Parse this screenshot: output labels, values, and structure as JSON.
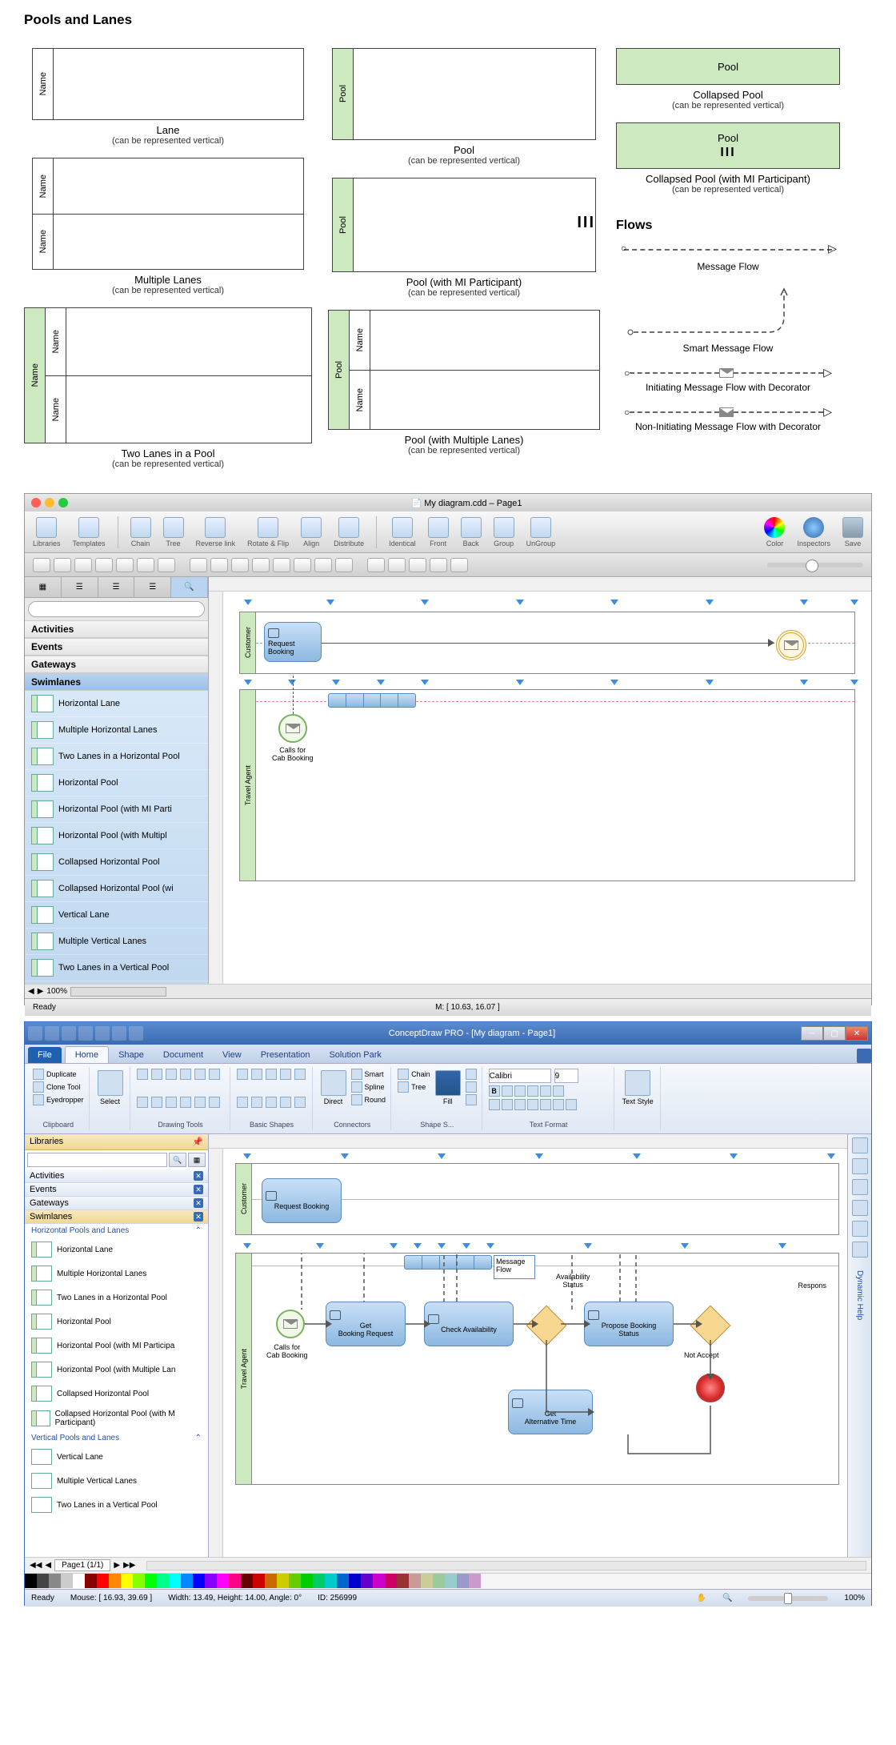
{
  "section_title": "Pools and Lanes",
  "shapes": {
    "lane": {
      "label": "Lane",
      "sub": "(can be represented vertical)",
      "name": "Name"
    },
    "multi_lanes": {
      "label": "Multiple Lanes",
      "sub": "(can be represented vertical)",
      "name1": "Name",
      "name2": "Name"
    },
    "two_lanes_pool": {
      "label": "Two Lanes in a Pool",
      "sub": "(can be represented vertical)",
      "pool": "Name",
      "lane1": "Name",
      "lane2": "Name"
    },
    "pool": {
      "label": "Pool",
      "sub": "(can be represented vertical)",
      "name": "Pool"
    },
    "pool_mi": {
      "label": "Pool (with MI Participant)",
      "sub": "(can be represented vertical)",
      "name": "Pool",
      "marker": "III"
    },
    "pool_multi": {
      "label": "Pool (with Multiple Lanes)",
      "sub": "(can be represented vertical)",
      "pool": "Pool",
      "lane1": "Name",
      "lane2": "Name"
    },
    "collapsed": {
      "label": "Collapsed Pool",
      "sub": "(can be represented vertical)",
      "name": "Pool"
    },
    "collapsed_mi": {
      "label": "Collapsed Pool (with MI Participant)",
      "sub": "(can be represented vertical)",
      "name": "Pool",
      "marker": "III"
    }
  },
  "flows": {
    "title": "Flows",
    "msg_flow": "Message Flow",
    "smart_msg_flow": "Smart Message Flow",
    "init_deco": "Initiating Message Flow with Decorator",
    "noninit_deco": "Non-Initiating Message Flow with Decorator"
  },
  "mac": {
    "title": "My diagram.cdd – Page1",
    "toolbar": [
      "Libraries",
      "Templates",
      "Chain",
      "Tree",
      "Reverse link",
      "Rotate & Flip",
      "Align",
      "Distribute",
      "Identical",
      "Front",
      "Back",
      "Group",
      "UnGroup",
      "Color",
      "Inspectors",
      "Save"
    ],
    "categories": [
      "Activities",
      "Events",
      "Gateways",
      "Swimlanes"
    ],
    "swimlane_items": [
      "Horizontal Lane",
      "Multiple Horizontal Lanes",
      "Two Lanes in a Horizontal Pool",
      "Horizontal Pool",
      "Horizontal Pool (with MI Parti",
      "Horizontal Pool (with Multipl",
      "Collapsed Horizontal Pool",
      "Collapsed Horizontal Pool (wi",
      "Vertical Lane",
      "Multiple Vertical Lanes",
      "Two Lanes in a Vertical Pool"
    ],
    "canvas": {
      "lane1": "Customer",
      "lane2": "Travel Agent",
      "task1": "Request Booking",
      "event1": "Calls for\nCab Booking"
    },
    "status": {
      "ready": "Ready",
      "zoom": "100%",
      "mouse": "M: [ 10.63, 16.07 ]"
    }
  },
  "win": {
    "title": "ConceptDraw PRO - [My diagram - Page1]",
    "tabs": [
      "File",
      "Home",
      "Shape",
      "Document",
      "View",
      "Presentation",
      "Solution Park"
    ],
    "clipboard": {
      "duplicate": "Duplicate",
      "clone": "Clone Tool",
      "eyedropper": "Eyedropper",
      "label": "Clipboard"
    },
    "groups": {
      "select": "Select",
      "drawing": "Drawing Tools",
      "shapes": "Basic Shapes",
      "direct": "Direct",
      "smart": "Smart",
      "spline": "Spline",
      "round": "Round",
      "connectors": "Connectors",
      "chain": "Chain",
      "tree": "Tree",
      "fill": "Fill",
      "shape_s": "Shape S...",
      "font": "Calibri",
      "font_size": "9",
      "text_format": "Text Format",
      "text_style": "Text Style"
    },
    "sidebar": {
      "header": "Libraries",
      "categories": [
        "Activities",
        "Events",
        "Gateways",
        "Swimlanes"
      ],
      "subcat1": "Horizontal Pools and Lanes",
      "subcat2": "Vertical Pools and Lanes",
      "items_h": [
        "Horizontal Lane",
        "Multiple Horizontal Lanes",
        "Two Lanes in a Horizontal Pool",
        "Horizontal Pool",
        "Horizontal Pool (with MI Participa",
        "Horizontal Pool (with Multiple Lan",
        "Collapsed Horizontal Pool",
        "Collapsed Horizontal Pool (with M Participant)"
      ],
      "items_v": [
        "Vertical Lane",
        "Multiple Vertical Lanes",
        "Two Lanes in a Vertical Pool"
      ]
    },
    "canvas": {
      "lane1": "Customer",
      "lane2": "Travel Agent",
      "task_req": "Request Booking",
      "event_call": "Calls for\nCab Booking",
      "task_get": "Get\nBooking Request",
      "task_check": "Check Availability",
      "msg_flow_label": "Message\nFlow",
      "avail_status": "Availability\nStatus",
      "task_propose": "Propose Booking\nStatus",
      "task_alt": "Get\nAlternative Time",
      "respons": "Respons",
      "not_accept": "Not Accept"
    },
    "pagebar": "Page1 (1/1)",
    "status": {
      "ready": "Ready",
      "mouse": "Mouse: [ 16.93, 39.69 ]",
      "size": "Width: 13.49,  Height: 14.00,  Angle: 0°",
      "id": "ID: 256999",
      "zoom": "100%"
    },
    "help": "Dynamic Help"
  },
  "colors": [
    "#000",
    "#444",
    "#888",
    "#ccc",
    "#fff",
    "#800",
    "#f00",
    "#f80",
    "#ff0",
    "#8f0",
    "#0f0",
    "#0f8",
    "#0ff",
    "#08f",
    "#00f",
    "#80f",
    "#f0f",
    "#f08",
    "#600",
    "#c00",
    "#c60",
    "#cc0",
    "#6c0",
    "#0c0",
    "#0c6",
    "#0cc",
    "#06c",
    "#00c",
    "#60c",
    "#c0c",
    "#c06",
    "#933",
    "#c99",
    "#cc9",
    "#9c9",
    "#9cc",
    "#99c",
    "#c9c"
  ]
}
